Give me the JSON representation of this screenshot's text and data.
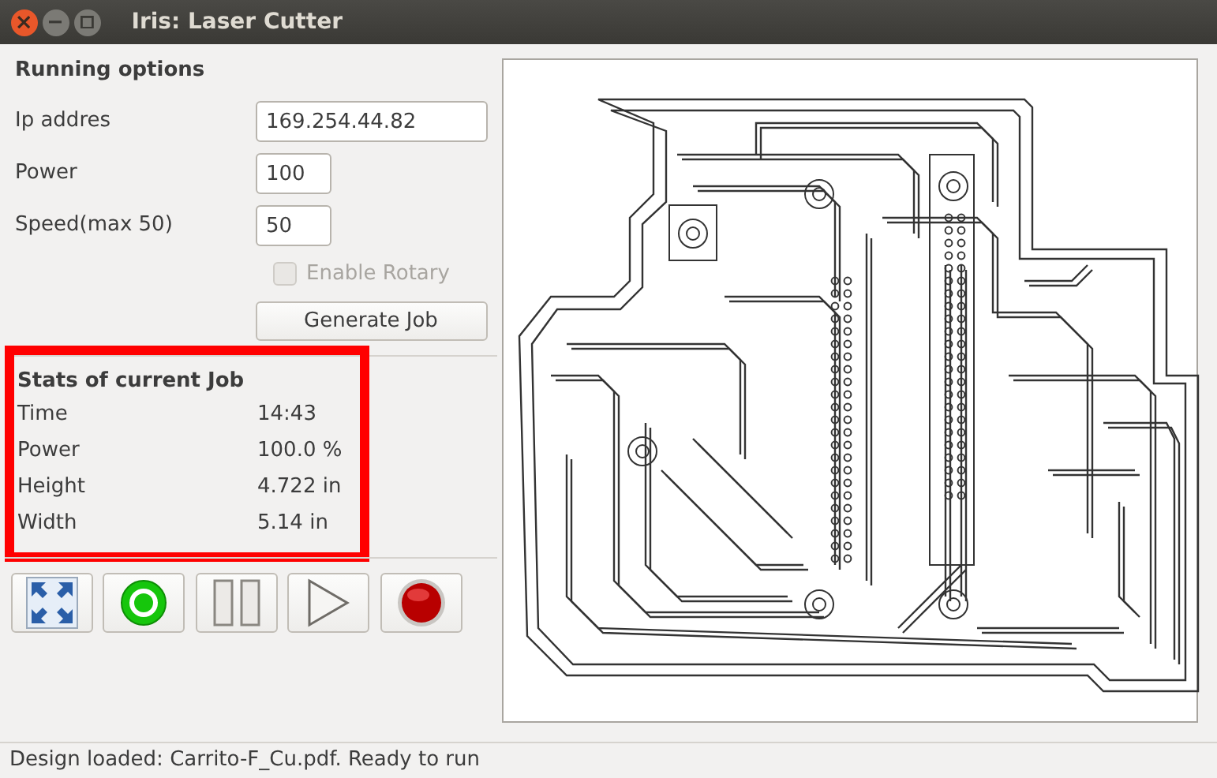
{
  "window": {
    "title": "Iris: Laser Cutter"
  },
  "running_options": {
    "heading": "Running options",
    "fields": [
      {
        "label": "Ip addres",
        "value": "169.254.44.82",
        "wide": true
      },
      {
        "label": "Power",
        "value": "100",
        "wide": false
      },
      {
        "label": "Speed(max 50)",
        "value": "50",
        "wide": false
      }
    ],
    "enable_rotary": {
      "label": "Enable Rotary",
      "checked": false,
      "disabled": true
    },
    "generate_button": "Generate Job"
  },
  "stats": {
    "heading": "Stats of current Job",
    "highlighted": true,
    "rows": [
      {
        "label": "Time",
        "value": "14:43"
      },
      {
        "label": "Power",
        "value": "100.0 %"
      },
      {
        "label": "Height",
        "value": "4.722 in"
      },
      {
        "label": "Width",
        "value": "5.14 in"
      }
    ]
  },
  "toolbar": [
    {
      "kind": "fit"
    },
    {
      "kind": "home"
    },
    {
      "kind": "pause"
    },
    {
      "kind": "play"
    },
    {
      "kind": "stop"
    }
  ],
  "status_bar": "Design loaded: Carrito-F_Cu.pdf. Ready to run"
}
